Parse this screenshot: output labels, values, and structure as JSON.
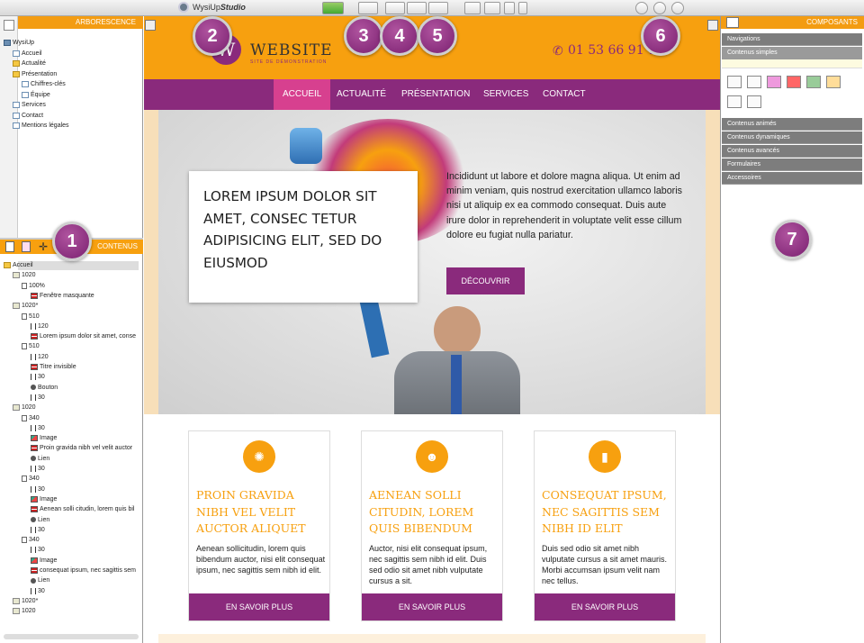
{
  "app": {
    "name": "WysiUp",
    "name_bold": "Studio"
  },
  "left_top_panel": {
    "title": "ARBORESCENCE",
    "items": [
      {
        "label": "WysiUp",
        "indent": 0,
        "icon": "home-icon"
      },
      {
        "label": "Accueil",
        "indent": 1,
        "icon": "page-icon"
      },
      {
        "label": "Actualité",
        "indent": 1,
        "icon": "folder-icon"
      },
      {
        "label": "Présentation",
        "indent": 1,
        "icon": "folder-icon"
      },
      {
        "label": "Chiffres-clés",
        "indent": 2,
        "icon": "page-icon"
      },
      {
        "label": "Équipe",
        "indent": 2,
        "icon": "page-icon"
      },
      {
        "label": "Services",
        "indent": 1,
        "icon": "page-icon"
      },
      {
        "label": "Contact",
        "indent": 1,
        "icon": "page-icon"
      },
      {
        "label": "Mentions légales",
        "indent": 1,
        "icon": "page-icon"
      }
    ]
  },
  "left_bottom_panel": {
    "title": "CONTENUS",
    "items": [
      {
        "label": "Accueil",
        "indent": 0,
        "icon": "folder"
      },
      {
        "label": "1020",
        "indent": 1,
        "icon": "box"
      },
      {
        "label": "100%",
        "indent": 2,
        "icon": "col"
      },
      {
        "label": "Fenêtre masquante",
        "indent": 3,
        "icon": "text"
      },
      {
        "label": "1020*",
        "indent": 1,
        "icon": "box"
      },
      {
        "label": "510",
        "indent": 2,
        "icon": "col"
      },
      {
        "label": "120",
        "indent": 3,
        "icon": "space"
      },
      {
        "label": "Lorem ipsum dolor sit amet, conse",
        "indent": 3,
        "icon": "text"
      },
      {
        "label": "510",
        "indent": 2,
        "icon": "col"
      },
      {
        "label": "120",
        "indent": 3,
        "icon": "space"
      },
      {
        "label": "Titre invisible",
        "indent": 3,
        "icon": "text"
      },
      {
        "label": "30",
        "indent": 3,
        "icon": "space"
      },
      {
        "label": "Bouton",
        "indent": 3,
        "icon": "link"
      },
      {
        "label": "30",
        "indent": 3,
        "icon": "space"
      },
      {
        "label": "1020",
        "indent": 1,
        "icon": "box"
      },
      {
        "label": "340",
        "indent": 2,
        "icon": "col"
      },
      {
        "label": "30",
        "indent": 3,
        "icon": "space"
      },
      {
        "label": "Image",
        "indent": 3,
        "icon": "img"
      },
      {
        "label": "Proin gravida nibh vel velit auctor",
        "indent": 3,
        "icon": "text"
      },
      {
        "label": "Lien",
        "indent": 3,
        "icon": "link"
      },
      {
        "label": "30",
        "indent": 3,
        "icon": "space"
      },
      {
        "label": "340",
        "indent": 2,
        "icon": "col"
      },
      {
        "label": "30",
        "indent": 3,
        "icon": "space"
      },
      {
        "label": "Image",
        "indent": 3,
        "icon": "img"
      },
      {
        "label": "Aenean solli citudin, lorem quis bil",
        "indent": 3,
        "icon": "text"
      },
      {
        "label": "Lien",
        "indent": 3,
        "icon": "link"
      },
      {
        "label": "30",
        "indent": 3,
        "icon": "space"
      },
      {
        "label": "340",
        "indent": 2,
        "icon": "col"
      },
      {
        "label": "30",
        "indent": 3,
        "icon": "space"
      },
      {
        "label": "Image",
        "indent": 3,
        "icon": "img"
      },
      {
        "label": "consequat ipsum, nec sagittis sem",
        "indent": 3,
        "icon": "text"
      },
      {
        "label": "Lien",
        "indent": 3,
        "icon": "link"
      },
      {
        "label": "30",
        "indent": 3,
        "icon": "space"
      },
      {
        "label": "1020*",
        "indent": 1,
        "icon": "box"
      },
      {
        "label": "1020",
        "indent": 1,
        "icon": "box"
      }
    ]
  },
  "right_panel": {
    "title": "COMPOSANTS",
    "sections": [
      "Navigations",
      "Contenus simples"
    ],
    "lower_sections": [
      "Contenus animés",
      "Contenus dynamiques",
      "Contenus avancés",
      "Formulaires",
      "Accessoires"
    ]
  },
  "site": {
    "logo_title": "WEBSITE",
    "logo_subtitle": "SITE DE DÉMONSTRATION",
    "logo_letter": "W",
    "phone": "01 53 66 91 18",
    "nav": [
      "ACCUEIL",
      "ACTUALITÉ",
      "PRÉSENTATION",
      "SERVICES",
      "CONTACT"
    ],
    "hero_title": "LOREM IPSUM DOLOR SIT AMET, CONSEC TETUR ADIPISICING ELIT, SED DO EIUSMOD",
    "hero_text": "Incididunt ut labore et dolore magna aliqua. Ut enim ad minim veniam, quis nostrud exercitation ullamco laboris nisi ut aliquip ex ea commodo consequat. Duis aute irure dolor in reprehenderit in voluptate velit esse cillum dolore eu fugiat nulla pariatur.",
    "hero_button": "DÉCOUVRIR",
    "cards": [
      {
        "title": "PROIN GRAVIDA NIBH VEL VELIT AUCTOR ALIQUET",
        "body": "Aenean sollicitudin, lorem quis bibendum auctor, nisi elit consequat ipsum, nec sagittis sem nibh id elit.",
        "button": "EN SAVOIR PLUS",
        "icon": "lightbulb-icon"
      },
      {
        "title": "AENEAN SOLLI CITUDIN, LOREM QUIS BIBENDUM",
        "body": "Auctor, nisi elit consequat ipsum, nec sagittis sem nibh id elit. Duis sed odio sit amet nibh vulputate cursus a sit.",
        "button": "EN SAVOIR PLUS",
        "icon": "users-icon"
      },
      {
        "title": "CONSEQUAT IPSUM, NEC SAGITTIS SEM NIBH ID ELIT",
        "body": "Duis sed odio sit amet nibh vulputate cursus a sit amet mauris. Morbi accumsan ipsum velit nam nec tellus.",
        "button": "EN SAVOIR PLUS",
        "icon": "bar-chart-icon"
      }
    ]
  },
  "badges": [
    "1",
    "2",
    "3",
    "4",
    "5",
    "6",
    "7"
  ],
  "colors": {
    "accent": "#f7a00f",
    "brand": "#8a2a7c",
    "panel_header": "#f39c12"
  }
}
